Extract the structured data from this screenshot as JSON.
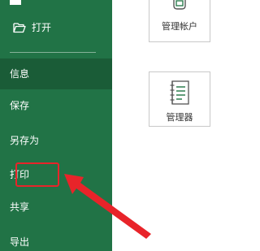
{
  "sidebar": {
    "open": "打开",
    "info": "信息",
    "save": "保存",
    "save_as": "另存为",
    "print": "打印",
    "share": "共享",
    "export": "导出"
  },
  "cards": {
    "account": "管理帐户",
    "manager": "管理器"
  },
  "colors": {
    "sidebar_bg": "#217346",
    "selected_bg": "#1a5c37",
    "highlight": "#e8242a"
  },
  "icons": {
    "open": "folder-open-icon",
    "account": "account-icon",
    "manager": "notebook-icon",
    "annotation": "red-arrow-icon"
  }
}
